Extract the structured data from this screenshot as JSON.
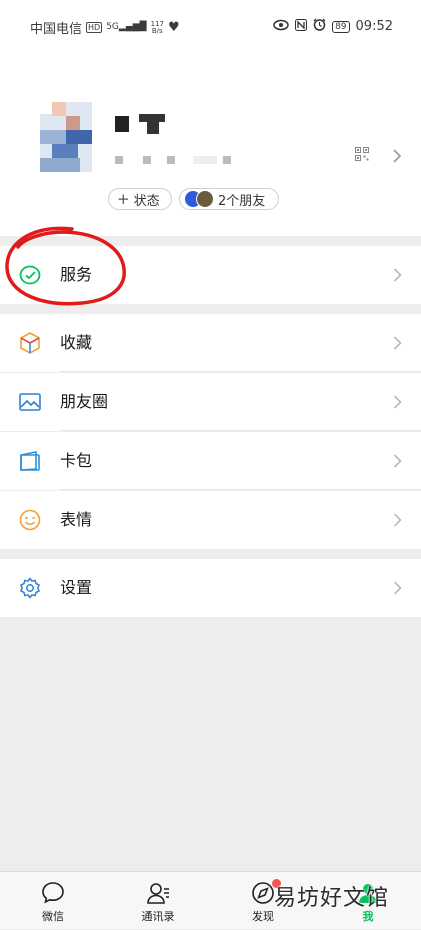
{
  "status_bar": {
    "carrier": "中国电信",
    "hd_badge": "HD",
    "signal_type": "5G",
    "net_speed_value": "117",
    "net_speed_unit": "B/s",
    "battery": "89",
    "time": "09:52"
  },
  "profile": {
    "status_button": "状态",
    "friends_button": "2个朋友"
  },
  "menu": {
    "services": "服务",
    "favorites": "收藏",
    "moments": "朋友圈",
    "cards": "卡包",
    "stickers": "表情",
    "settings": "设置"
  },
  "tabs": [
    {
      "label": "微信"
    },
    {
      "label": "通讯录"
    },
    {
      "label": "发现"
    },
    {
      "label": "我"
    }
  ],
  "watermark": "易坊好文馆",
  "colors": {
    "accent_green": "#07c160",
    "annotation_red": "#e11b1b",
    "badge_red": "#fa5151",
    "moments_blue": "#2f7fd6",
    "cards_blue": "#2f8fd6",
    "stickers_orange": "#f0a030"
  }
}
